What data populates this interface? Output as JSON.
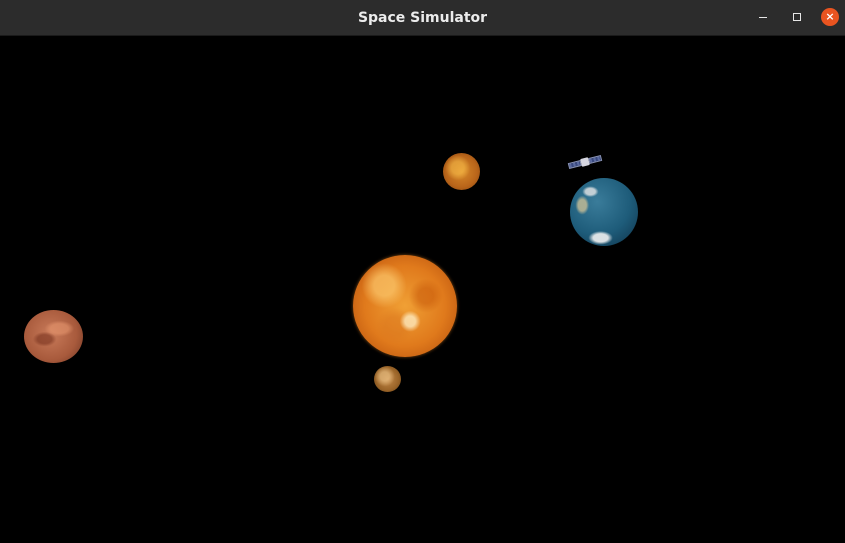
{
  "window": {
    "title": "Space Simulator",
    "buttons": {
      "minimize_icon": "minimize-icon",
      "maximize_icon": "maximize-icon",
      "close_icon": "close-icon",
      "close_glyph": "×",
      "close_color": "#e95420"
    }
  },
  "scene": {
    "background_color": "#000000",
    "bodies": [
      "sun",
      "venus",
      "earth",
      "mars",
      "mercury",
      "satellite"
    ]
  }
}
